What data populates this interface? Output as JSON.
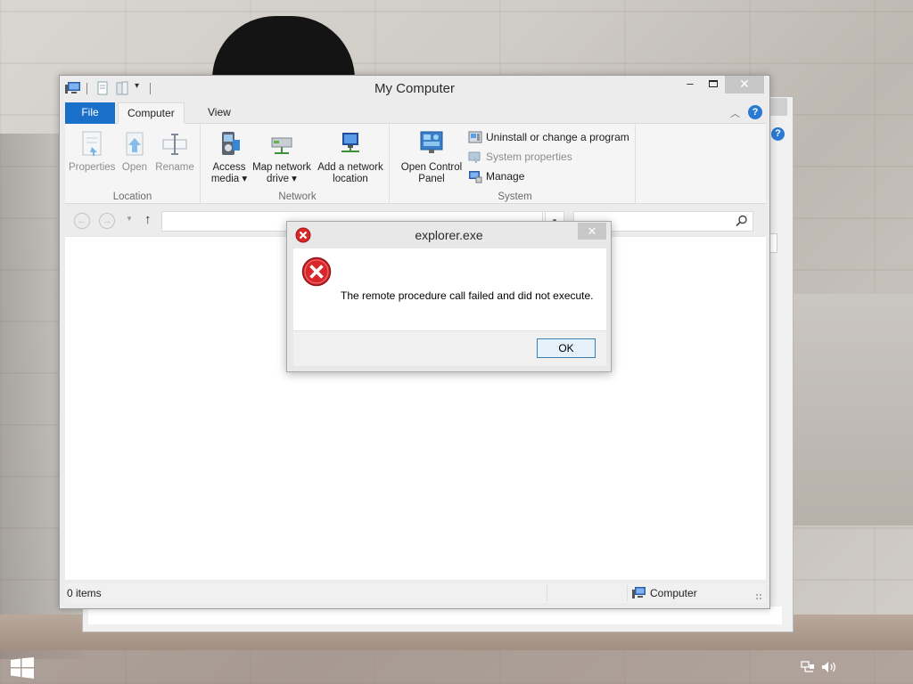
{
  "explorer": {
    "title": "My Computer",
    "tabs": {
      "file": "File",
      "computer": "Computer",
      "view": "View"
    },
    "help": "?",
    "ribbon": {
      "location": {
        "label": "Location",
        "properties": "Properties",
        "open": "Open",
        "rename": "Rename"
      },
      "network": {
        "label": "Network",
        "access_media_1": "Access",
        "access_media_2": "media ▾",
        "map_drive_1": "Map network",
        "map_drive_2": "drive ▾",
        "add_location_1": "Add a network",
        "add_location_2": "location"
      },
      "system": {
        "label": "System",
        "control_panel_1": "Open Control",
        "control_panel_2": "Panel",
        "uninstall": "Uninstall or change a program",
        "system_properties": "System properties",
        "manage": "Manage"
      }
    },
    "address": {
      "value": ""
    },
    "search": {
      "placeholder": ""
    },
    "status": {
      "items": "0 items",
      "location": "Computer"
    }
  },
  "dialog": {
    "title": "explorer.exe",
    "message": "The remote procedure call failed and did not execute.",
    "ok": "OK"
  },
  "colors": {
    "file_tab": "#1a6fc9",
    "error_red": "#d9262b",
    "help_blue": "#2a7ad4"
  }
}
